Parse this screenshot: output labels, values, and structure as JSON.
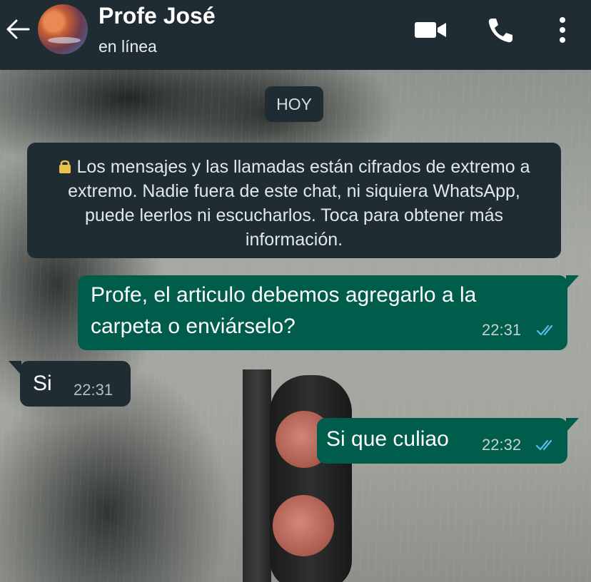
{
  "header": {
    "back_icon": "arrow-left-icon",
    "contact_name": "Profe José",
    "status": "en línea",
    "actions": [
      "video-camera-icon",
      "phone-icon",
      "more-vertical-icon"
    ],
    "background_color": "#1f2c34"
  },
  "chat": {
    "date_chip": "HOY",
    "encryption_notice": "Los mensajes y las llamadas están cifrados de extremo a extremo. Nadie fuera de este chat, ni siquiera WhatsApp, puede leerlos ni escucharlos. Toca para obtener más información.",
    "messages": [
      {
        "direction": "outgoing",
        "text": "Profe, el articulo debemos agregarlo a la carpeta o enviárselo?",
        "time": "22:31",
        "status": "read-ticks"
      },
      {
        "direction": "incoming",
        "text": "Si",
        "time": "22:31"
      },
      {
        "direction": "outgoing",
        "text": "Si que culiao",
        "time": "22:32",
        "status": "read-ticks"
      }
    ],
    "colors": {
      "outgoing_bubble": "#005c4b",
      "incoming_bubble": "#1f2c34",
      "read_ticks": "#53bdeb"
    }
  }
}
